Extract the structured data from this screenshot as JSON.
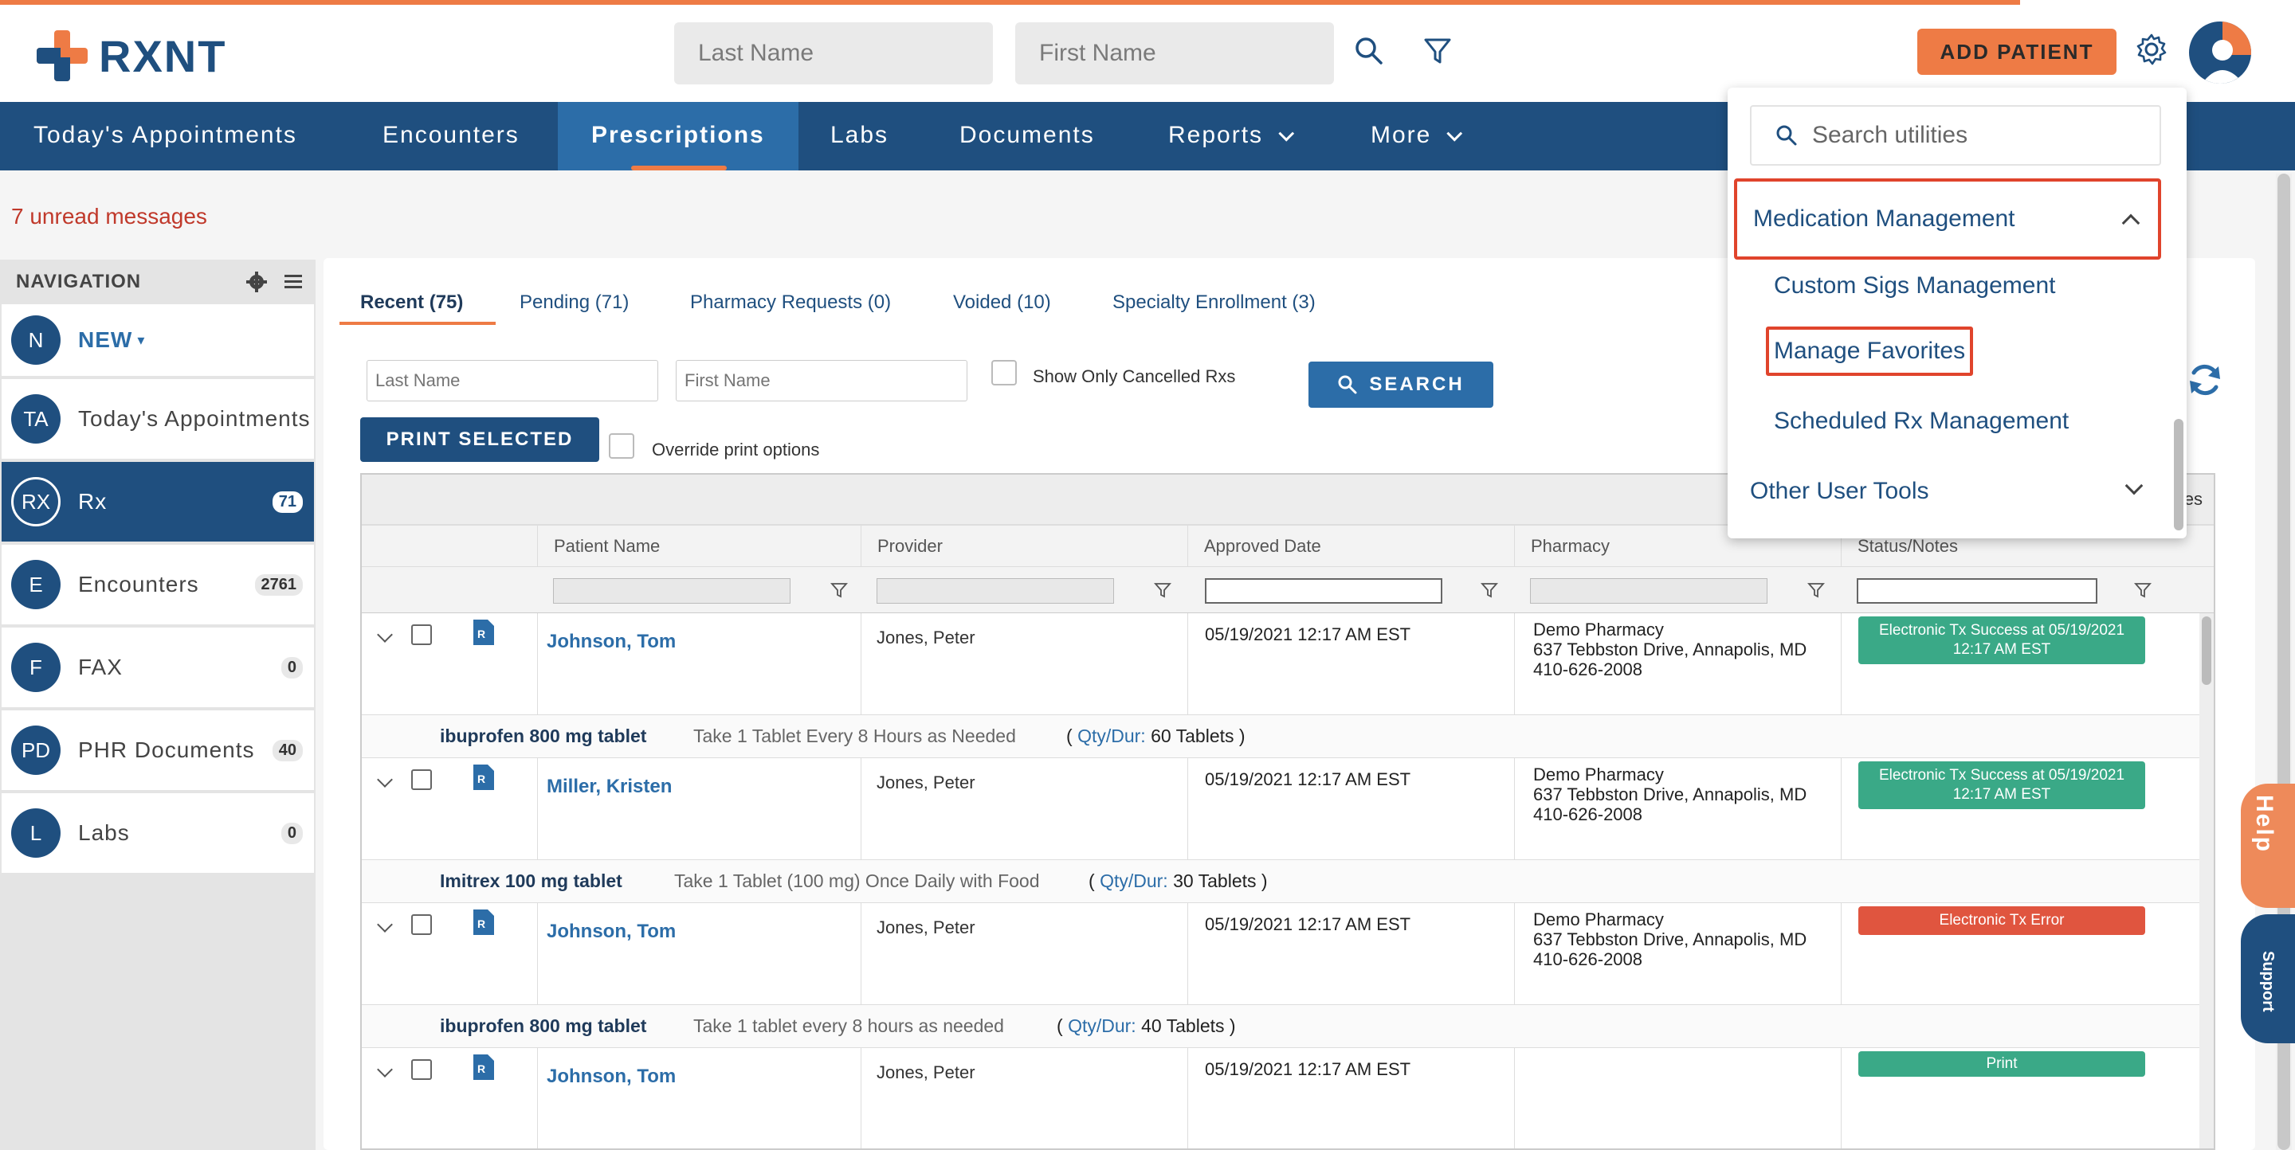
{
  "header": {
    "brand": "RXNT",
    "last_name_placeholder": "Last Name",
    "first_name_placeholder": "First Name",
    "add_patient_label": "ADD PATIENT"
  },
  "mainnav": {
    "items": [
      {
        "label": "Today's Appointments"
      },
      {
        "label": "Encounters"
      },
      {
        "label": "Prescriptions"
      },
      {
        "label": "Labs"
      },
      {
        "label": "Documents"
      },
      {
        "label": "Reports"
      },
      {
        "label": "More"
      }
    ],
    "active": "Prescriptions"
  },
  "messages": {
    "unread": "7 unread messages"
  },
  "leftnav": {
    "title": "NAVIGATION",
    "new_label": "NEW",
    "items": [
      {
        "abbr": "N",
        "label": "NEW"
      },
      {
        "abbr": "TA",
        "label": "Today's Appointments",
        "badge": ""
      },
      {
        "abbr": "RX",
        "label": "Rx",
        "badge": "71"
      },
      {
        "abbr": "E",
        "label": "Encounters",
        "badge": "2761"
      },
      {
        "abbr": "F",
        "label": "FAX",
        "badge": "0"
      },
      {
        "abbr": "PD",
        "label": "PHR Documents",
        "badge": "40"
      },
      {
        "abbr": "L",
        "label": "Labs",
        "badge": "0"
      }
    ]
  },
  "tabs": [
    {
      "label": "Recent (75)"
    },
    {
      "label": "Pending (71)"
    },
    {
      "label": "Pharmacy Requests (0)"
    },
    {
      "label": "Voided (10)"
    },
    {
      "label": "Specialty Enrollment (3)"
    }
  ],
  "filters": {
    "last_name_placeholder": "Last Name",
    "first_name_placeholder": "First Name",
    "cancelled_label": "Show Only Cancelled Rxs",
    "search_label": "SEARCH",
    "print_selected_label": "PRINT SELECTED",
    "override_label": "Override print options"
  },
  "grid": {
    "toolbar_partial": "es",
    "columns": [
      "Patient Name",
      "Provider",
      "Approved Date",
      "Pharmacy",
      "Status/Notes"
    ],
    "rows": [
      {
        "patient": "Johnson, Tom",
        "provider": "Jones, Peter",
        "approved": "05/19/2021 12:17 AM EST",
        "pharmacy": [
          "Demo Pharmacy",
          "637 Tebbston Drive, Annapolis, MD",
          "410-626-2008"
        ],
        "status": "Electronic Tx Success at 05/19/2021 12:17 AM EST",
        "status_type": "ok",
        "drug": "ibuprofen 800 mg tablet",
        "sig": "Take 1 Tablet Every 8 Hours as Needed",
        "qty_label": "Qty/Dur:",
        "qty": "60 Tablets"
      },
      {
        "patient": "Miller, Kristen",
        "provider": "Jones, Peter",
        "approved": "05/19/2021 12:17 AM EST",
        "pharmacy": [
          "Demo Pharmacy",
          "637 Tebbston Drive, Annapolis, MD",
          "410-626-2008"
        ],
        "status": "Electronic Tx Success at 05/19/2021 12:17 AM EST",
        "status_type": "ok",
        "drug": "Imitrex 100 mg tablet",
        "sig": "Take 1 Tablet (100 mg) Once Daily with Food",
        "qty_label": "Qty/Dur:",
        "qty": "30 Tablets"
      },
      {
        "patient": "Johnson, Tom",
        "provider": "Jones, Peter",
        "approved": "05/19/2021 12:17 AM EST",
        "pharmacy": [
          "Demo Pharmacy",
          "637 Tebbston Drive, Annapolis, MD",
          "410-626-2008"
        ],
        "status": "Electronic Tx Error",
        "status_type": "err",
        "drug": "ibuprofen 800 mg tablet",
        "sig": "Take 1 tablet every 8 hours as needed",
        "qty_label": "Qty/Dur:",
        "qty": "40 Tablets"
      },
      {
        "patient": "Johnson, Tom",
        "provider": "Jones, Peter",
        "approved": "05/19/2021 12:17 AM EST",
        "pharmacy": [
          "",
          "",
          ""
        ],
        "status": "Print",
        "status_type": "ok"
      }
    ]
  },
  "utilities": {
    "search_placeholder": "Search utilities",
    "section1": "Medication Management",
    "sub1": "Custom Sigs Management",
    "sub2": "Manage Favorites",
    "sub3": "Scheduled Rx Management",
    "section2": "Other User Tools"
  },
  "side": {
    "help": "Help",
    "support": "Support"
  },
  "colors": {
    "brand_navy": "#1f4f7f",
    "brand_orange": "#ee7b45",
    "success": "#3aa987",
    "error": "#e0553f"
  }
}
